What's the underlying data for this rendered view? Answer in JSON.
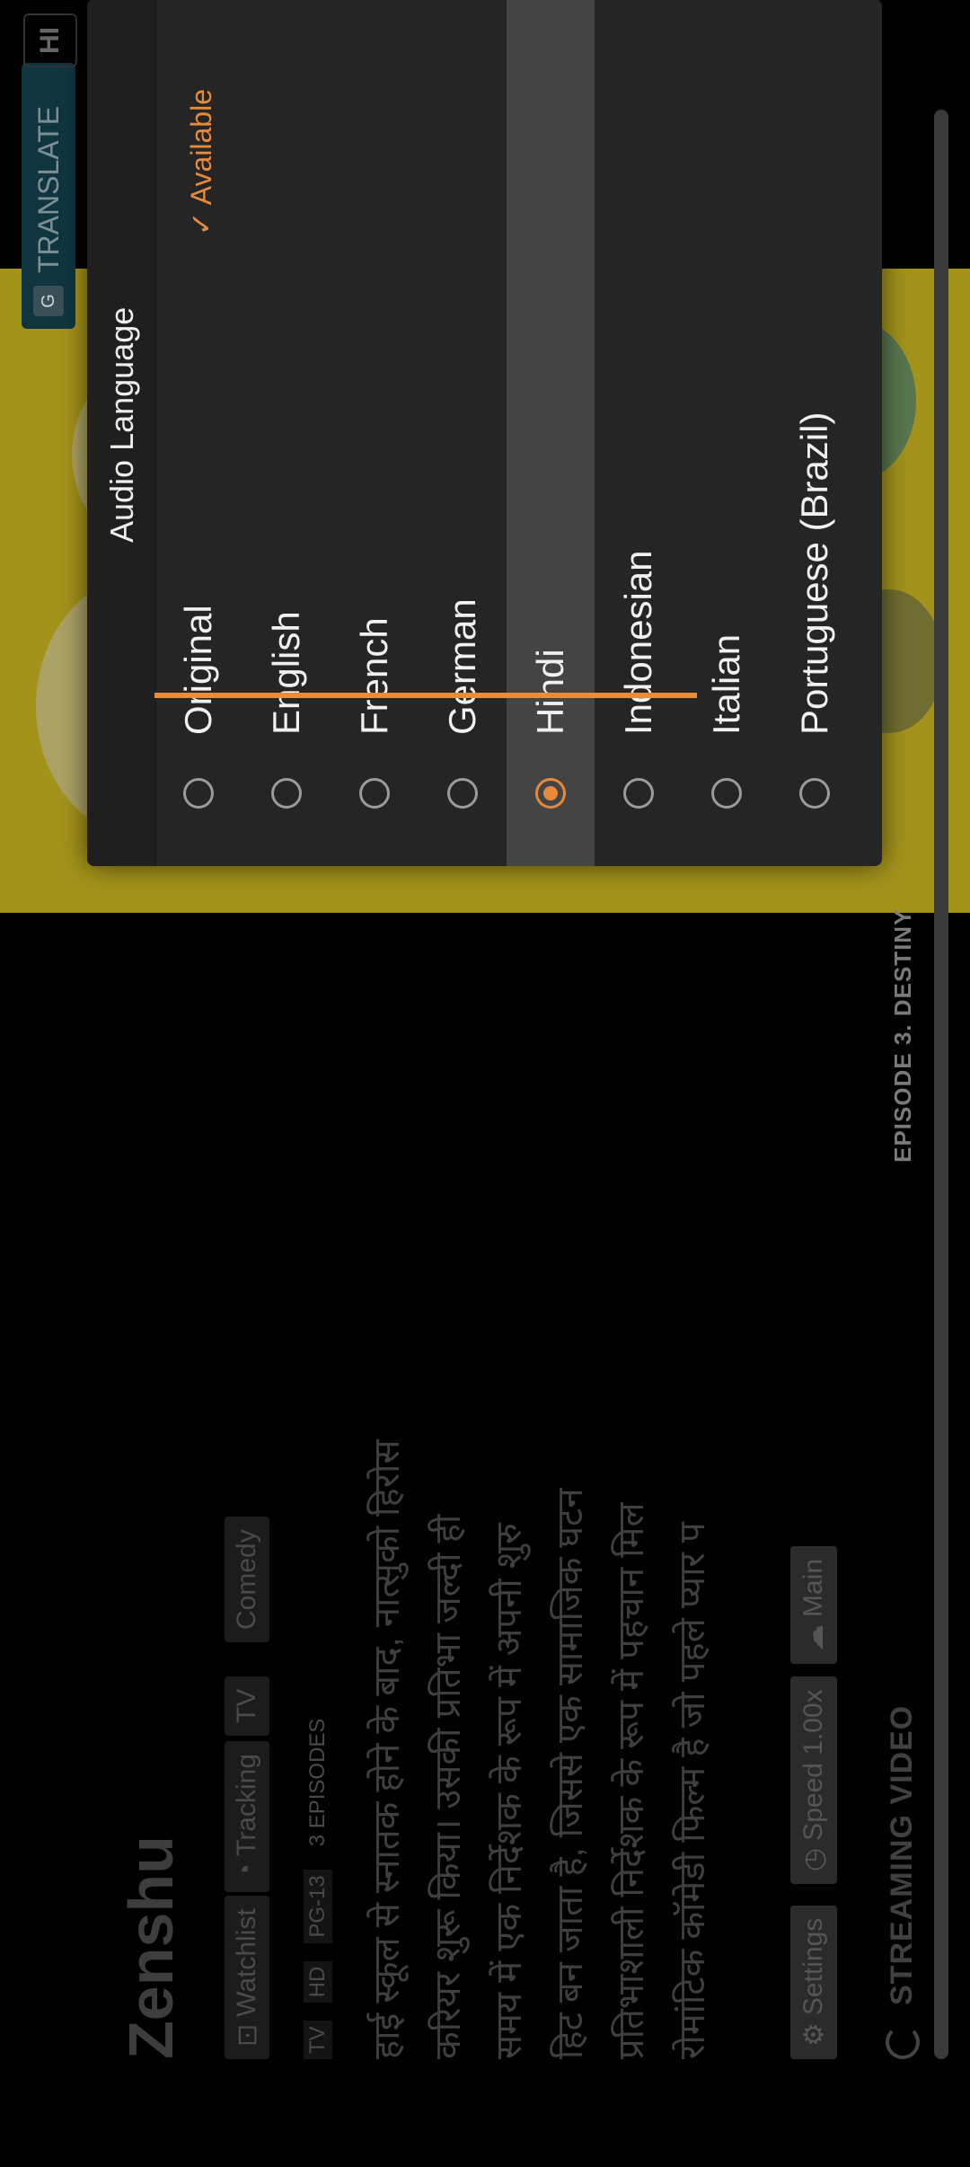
{
  "translate": {
    "icon": "google-translate-icon",
    "label": "TRANSLATE"
  },
  "hi_badge": "HI",
  "page": {
    "title": "Zenshu",
    "chips": {
      "watchlist": "Watchlist",
      "tracking": "Tracking",
      "tv": "TV",
      "comedy": "Comedy"
    },
    "meta": [
      "TV",
      "HD",
      "PG-13",
      "3 EPISODES"
    ],
    "description_lines": [
      "हाई स्कूल से स्नातक होने के बाद, नात्सुको हिरोस",
      "करियर शुरू किया। उसकी प्रतिभा जल्दी ही",
      "समय में एक निर्देशक के रूप में अपनी शुरु",
      "हिट बन जाता है, जिससे एक सामाजिक घटन",
      "प्रतिभाशाली निर्देशक के रूप में पहचान मिल",
      "रोमांटिक कॉमेडी फिल्म है जो पहले प्यार प"
    ],
    "buttons": {
      "settings": "Settings",
      "speed": "Speed 1.00x",
      "main": "Main"
    },
    "streaming_label": "STREAMING VIDEO",
    "episode_label": "EPISODE 3. DESTINY"
  },
  "dialog": {
    "title": "Audio Language",
    "available": "✓ Available",
    "selected_index": 4,
    "options": [
      "Original",
      "English",
      "French",
      "German",
      "Hindi",
      "Indonesian",
      "Italian",
      "Portuguese (Brazil)"
    ]
  },
  "colors": {
    "accent": "#e98c3c",
    "dialog_bg": "#252525",
    "selected_row": "#444444"
  }
}
